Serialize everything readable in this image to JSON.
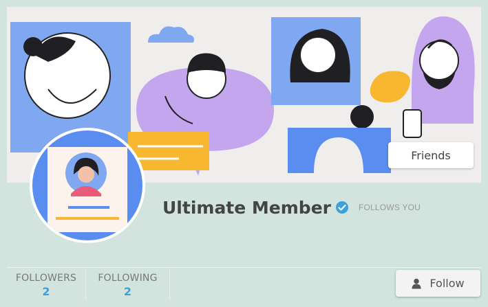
{
  "profile": {
    "name": "Ultimate Member",
    "follows_you": "FOLLOWS YOU",
    "verified_icon": "verified-check-icon"
  },
  "actions": {
    "friends_label": "Friends",
    "follow_label": "Follow",
    "follow_icon": "user-icon"
  },
  "stats": [
    {
      "label": "FOLLOWERS",
      "count": "2"
    },
    {
      "label": "FOLLOWING",
      "count": "2"
    }
  ],
  "colors": {
    "page_bg": "#d3e4df",
    "accent_blue": "#3ba1da",
    "cover_blue": "#7fa8f0",
    "cover_purple": "#c4a6ef",
    "cover_yellow": "#f7b731"
  }
}
